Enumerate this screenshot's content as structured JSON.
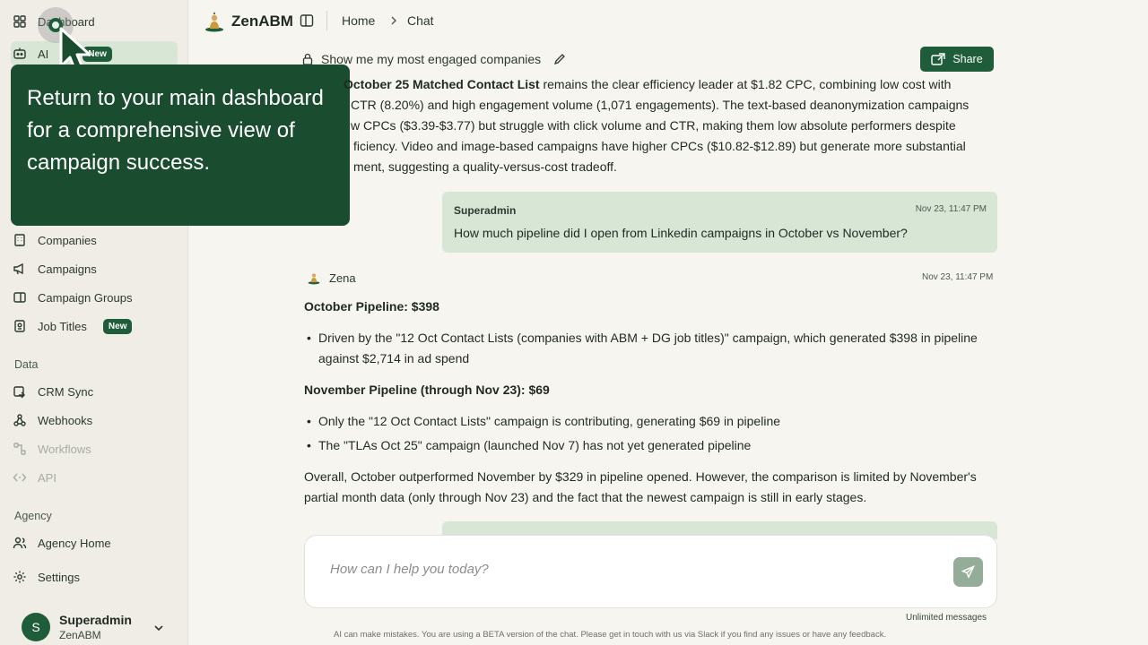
{
  "sidebar": {
    "items": [
      {
        "label": "Dashboard",
        "icon": "grid-icon"
      },
      {
        "label": "AI",
        "badge": "New",
        "icon": "bot-icon"
      },
      {
        "label": "Companies",
        "icon": "building-icon"
      },
      {
        "label": "Campaigns",
        "icon": "megaphone-icon"
      },
      {
        "label": "Campaign Groups",
        "icon": "folder-icon"
      },
      {
        "label": "Job Titles",
        "badge": "New",
        "icon": "id-badge-icon"
      }
    ],
    "data_section": "Data",
    "data_items": [
      {
        "label": "CRM Sync",
        "icon": "sync-icon"
      },
      {
        "label": "Webhooks",
        "icon": "webhook-icon"
      },
      {
        "label": "Workflows",
        "icon": "workflow-icon"
      },
      {
        "label": "API",
        "icon": "code-icon"
      }
    ],
    "agency_section": "Agency",
    "agency_items": [
      {
        "label": "Agency Home",
        "icon": "users-icon"
      },
      {
        "label": "Settings",
        "icon": "gear-icon"
      }
    ],
    "user": {
      "initial": "S",
      "name": "Superadmin",
      "org": "ZenABM"
    }
  },
  "tooltip": {
    "text": "Return to your main dashboard for a comprehensive view of campaign success."
  },
  "header": {
    "brand": "ZenABM",
    "breadcrumb": [
      "Home",
      "Chat"
    ]
  },
  "chat": {
    "title": "Show me my most engaged companies",
    "share_label": "Share",
    "intro_lines": [
      {
        "bold": "October 25 Matched Contact List",
        "rest": " remains the clear efficiency leader at $1.82 CPC, combining low cost with"
      },
      {
        "bold": "",
        "rest": "CTR (8.20%) and high engagement volume (1,071 engagements). The text-based deanonymization campaigns"
      },
      {
        "bold": "",
        "rest": "w CPCs ($3.39-$3.77) but struggle with click volume and CTR, making them low absolute performers despite"
      },
      {
        "bold": "",
        "rest": "ficiency. Video and image-based campaigns have higher CPCs ($10.82-$12.89) but generate more substantial"
      },
      {
        "bold": "",
        "rest": "ment, suggesting a quality-versus-cost tradeoff."
      }
    ],
    "user_message": {
      "author": "Superadmin",
      "time": "Nov 23, 11:47 PM",
      "text": "How much pipeline did I open from Linkedin campaigns in October vs November?"
    },
    "bot_message": {
      "author": "Zena",
      "time": "Nov 23, 11:47 PM",
      "oct_heading": "October Pipeline: $398",
      "oct_bullet": "Driven by the \"12 Oct Contact Lists (companies with ABM + DG job titles)\" campaign, which generated $398 in pipeline against $2,714 in ad spend",
      "nov_heading": "November Pipeline (through Nov 23): $69",
      "nov_bullet_1": "Only the \"12 Oct Contact Lists\" campaign is contributing, generating $69 in pipeline",
      "nov_bullet_2": "The \"TLAs Oct 25\" campaign (launched Nov 7) has not yet generated pipeline",
      "summary": "Overall, October outperformed November by $329 in pipeline opened. However, the comparison is limited by November's partial month data (only through Nov 23) and the fact that the newest campaign is still in early stages."
    },
    "input_placeholder": "How can I help you today?",
    "limit_text": "Unlimited messages",
    "disclaimer": "AI can make mistakes. You are using a BETA version of the chat. Please get in touch with us via Slack if you find any issues or have any feedback."
  },
  "colors": {
    "brand_green": "#1f5c3a",
    "bubble": "#d8e6d6",
    "background": "#f7f5ef"
  }
}
